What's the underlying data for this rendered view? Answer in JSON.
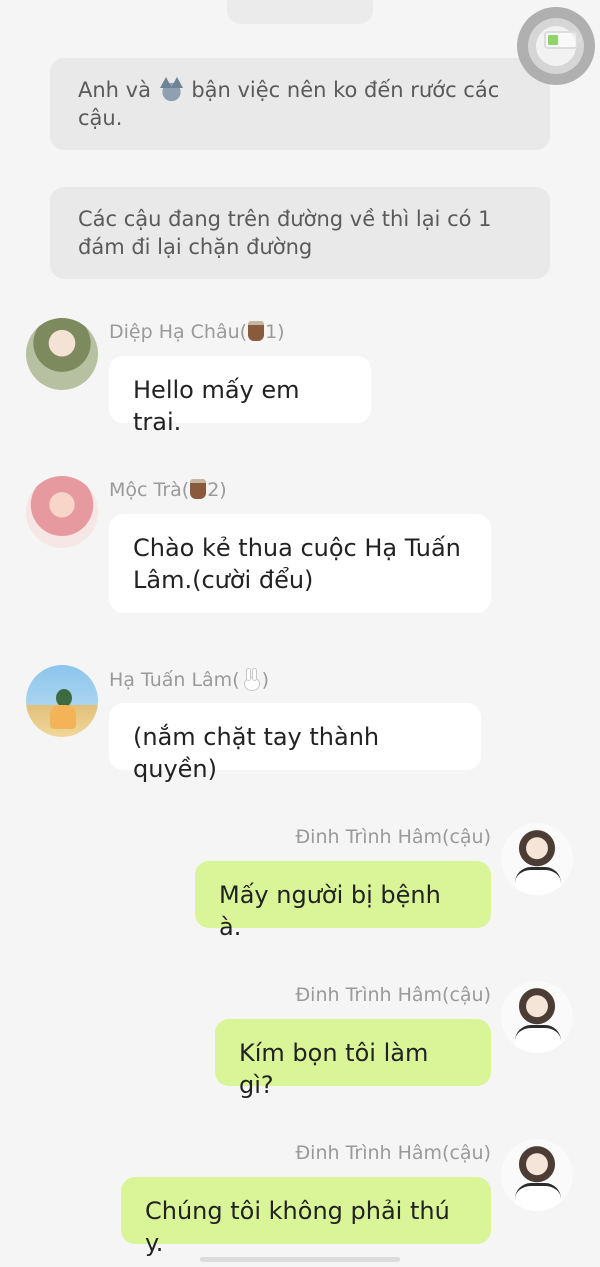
{
  "narration": [
    {
      "before": "Anh và ",
      "icon": "wolf-icon",
      "after": " bận việc nên ko đến rước các cậu."
    },
    {
      "text": "Các cậu đang trên đường về thì lại có 1 đám đi lại chặn đường"
    }
  ],
  "messages": [
    {
      "sender": "Diệp Hạ Châu(",
      "sender_icon": "cup-icon",
      "sender_suffix": "1)",
      "text": "Hello mấy em trai.",
      "side": "left"
    },
    {
      "sender": "Mộc Trà(",
      "sender_icon": "cup-icon",
      "sender_suffix": "2)",
      "text": "Chào kẻ thua cuộc Hạ Tuấn Lâm.(cười đểu)",
      "side": "left"
    },
    {
      "sender": "Hạ Tuấn Lâm(",
      "sender_icon": "bunny-icon",
      "sender_suffix": ")",
      "text": "(nắm chặt tay thành quyền)",
      "side": "left"
    },
    {
      "sender": "Đinh Trình Hâm(cậu)",
      "text": "Mấy người bị bệnh à.",
      "side": "right"
    },
    {
      "sender": "Đinh Trình Hâm(cậu)",
      "text": "Kím bọn tôi làm gì?",
      "side": "right"
    },
    {
      "sender": "Đinh Trình Hâm(cậu)",
      "text": "Chúng tôi không phải thú y.",
      "side": "right"
    }
  ],
  "colors": {
    "background": "#f5f5f5",
    "narration_bg": "#e9e9e9",
    "left_bubble": "#ffffff",
    "right_bubble": "#d9f597",
    "name_text": "#9a9a9a"
  }
}
